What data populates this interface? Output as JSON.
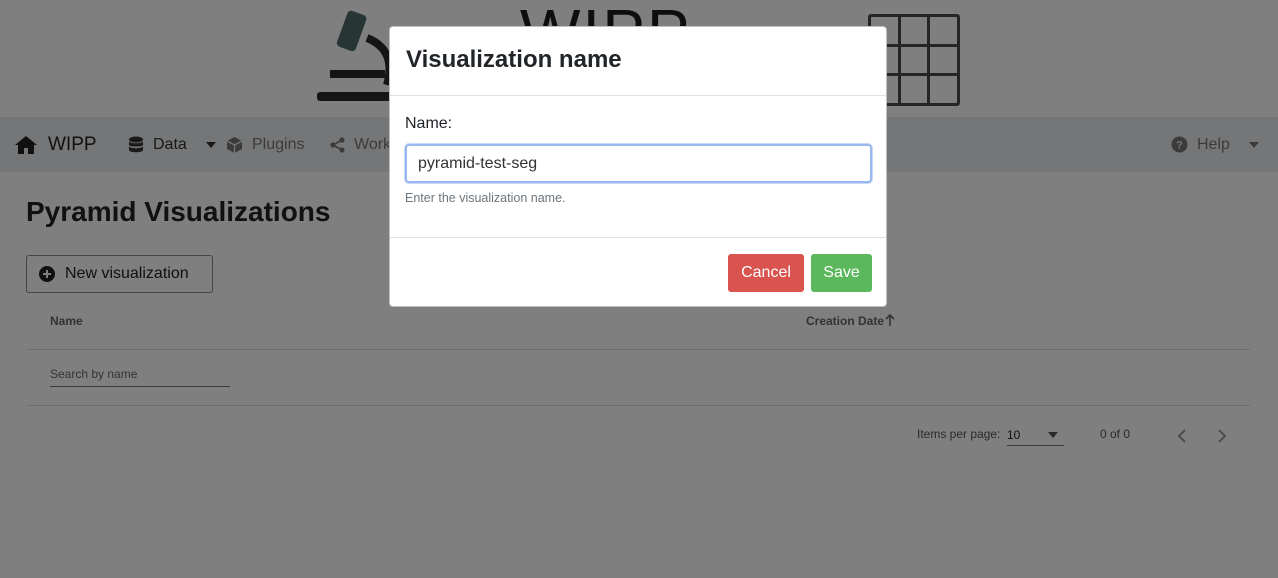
{
  "navbar": {
    "brand": "WIPP",
    "items": [
      {
        "label": "Data"
      },
      {
        "label": "Plugins"
      },
      {
        "label": "Work"
      }
    ],
    "help": "Help"
  },
  "page": {
    "title": "Pyramid Visualizations",
    "new_button": "New visualization",
    "table": {
      "columns": [
        "Name",
        "Creation Date"
      ],
      "sort_indicator": "arrow-up-icon",
      "search_placeholder": "Search by name"
    },
    "paginator": {
      "items_per_page_label": "Items per page:",
      "items_per_page_value": "10",
      "range": "0 of 0"
    }
  },
  "modal": {
    "title": "Visualization name",
    "field_label": "Name:",
    "field_value": "pyramid-test-seg",
    "help_text": "Enter the visualization name.",
    "cancel_label": "Cancel",
    "save_label": "Save"
  },
  "colors": {
    "cancel": "#d9534f",
    "save": "#5cb85c",
    "input_focus": "#99b8f0"
  }
}
